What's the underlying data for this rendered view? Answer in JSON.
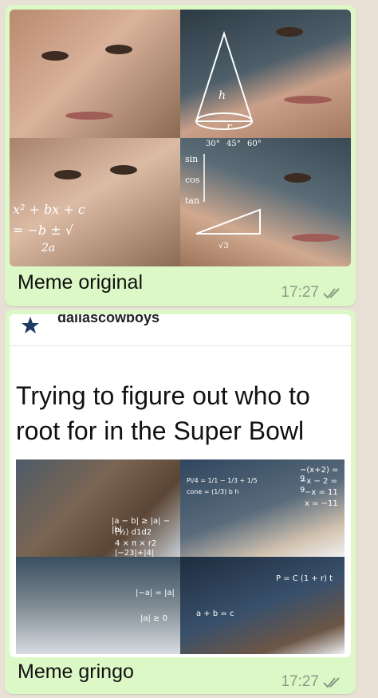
{
  "messages": [
    {
      "caption": "Meme original",
      "time": "17:27",
      "image": {
        "overlay_math": [
          "sin",
          "cos",
          "tan",
          "30°",
          "45°",
          "60°",
          "h",
          "r",
          "x² + bx + c",
          "= −b ± √",
          "2a",
          "√3"
        ]
      }
    },
    {
      "caption": "Meme gringo",
      "time": "17:27",
      "post": {
        "account": "dallascowboys",
        "title": "Trying to figure out who to root for in the Super Bowl",
        "overlay_math": [
          "|a − b| ≥ |a| − |b|",
          "(½) d1d2",
          "4 × π × r2",
          "|−23|+|4|",
          "Pi/4 = 1/1 − 1/3 + 1/5",
          "cone = (1/3) b h",
          "−(x+2) = 9",
          "−x − 2 = 9",
          "−x = 11",
          "x = −11",
          "|−a| = |a|",
          "|a| ≥ 0",
          "P = C (1 + r) t",
          "a + b = c"
        ]
      }
    }
  ],
  "colors": {
    "bubble": "#dcf8c6",
    "meta": "#8a9a86",
    "background": "#e8e0d5"
  }
}
